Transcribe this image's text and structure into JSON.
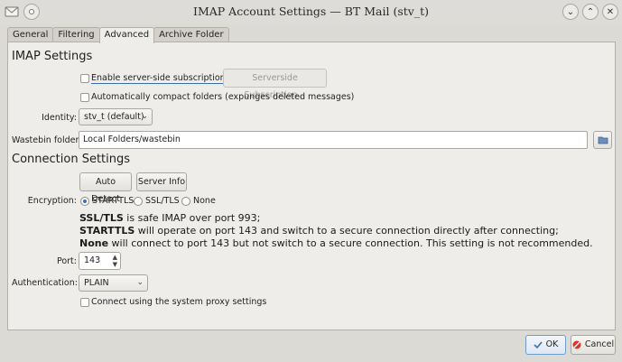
{
  "window": {
    "title": "IMAP Account Settings — BT Mail (stv_t)"
  },
  "tabs": [
    "General",
    "Filtering",
    "Advanced",
    "Archive Folder"
  ],
  "imap": {
    "section_title": "IMAP Settings",
    "enable_subscriptions_label": "Enable server-side subscriptions",
    "serverside_subscription_button": "Serverside Subscription...",
    "auto_compact_label": "Automatically compact folders (expunges deleted messages)",
    "identity_label": "Identity:",
    "identity_value": "stv_t (default)",
    "wastebin_label": "Wastebin folder:",
    "wastebin_value": "Local Folders/wastebin"
  },
  "connection": {
    "section_title": "Connection Settings",
    "auto_detect_button": "Auto Detect",
    "server_info_button": "Server Info",
    "encryption_label": "Encryption:",
    "encryption_options": [
      "STARTTLS",
      "SSL/TLS",
      "None"
    ],
    "encryption_selected": "STARTTLS",
    "info_line1_bold": "SSL/TLS",
    "info_line1_rest": " is safe IMAP over port 993;",
    "info_line2_bold": "STARTTLS",
    "info_line2_rest": " will operate on port 143 and switch to a secure connection directly after connecting;",
    "info_line3_bold": "None",
    "info_line3_rest": " will connect to port 143 but not switch to a secure connection. This setting is not recommended.",
    "port_label": "Port:",
    "port_value": "143",
    "auth_label": "Authentication:",
    "auth_value": "PLAIN",
    "proxy_label": "Connect using the system proxy settings"
  },
  "dialog": {
    "ok_label": "OK",
    "cancel_label": "Cancel"
  },
  "colors": {
    "background": "#dcdad5",
    "panel": "#eeedea",
    "accent": "#3b6fb0",
    "cancel_icon": "#d9342b"
  }
}
